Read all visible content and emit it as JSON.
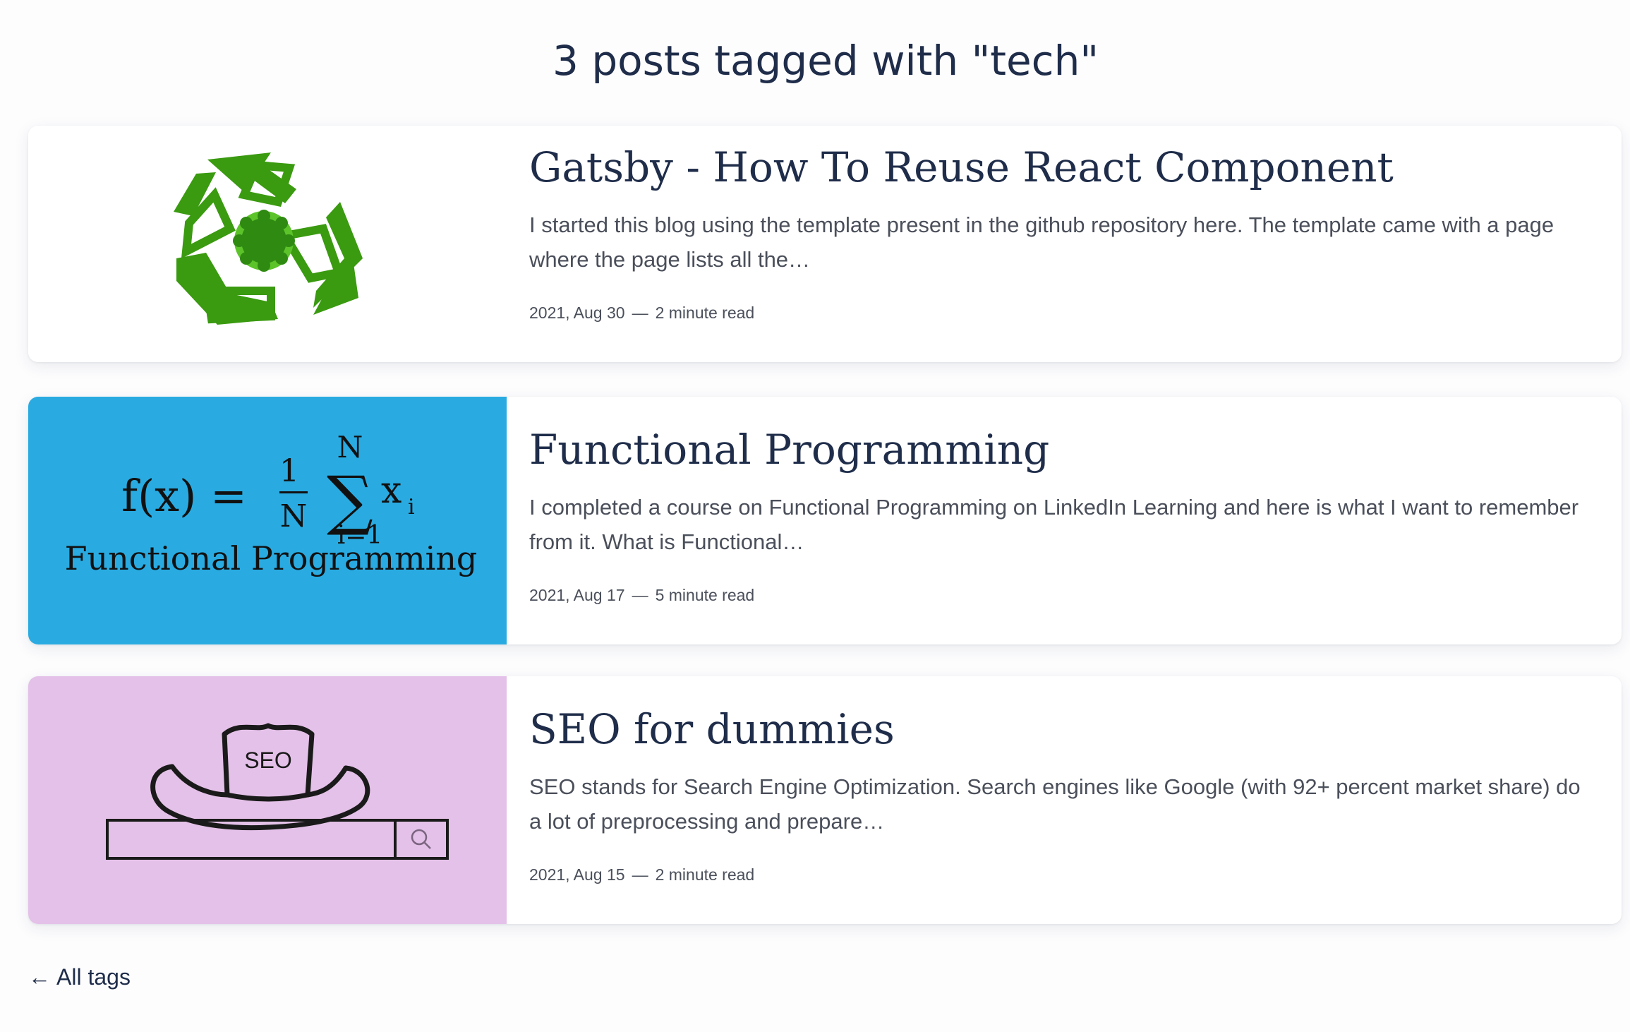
{
  "page": {
    "heading": "3 posts tagged with \"tech\""
  },
  "posts": [
    {
      "title": "Gatsby - How To Reuse React Component",
      "excerpt": "I started this blog using the template present in the github repository here. The template came with a page where the page lists all the…",
      "date": "2021, Aug 30",
      "read_time": "2 minute read",
      "thumbnail_icon": "recycle-icon",
      "thumbnail_bg": "#ffffff"
    },
    {
      "title": "Functional Programming",
      "excerpt": "I completed a course on Functional Programming on LinkedIn Learning and here is what I want to remember from it. What is Functional…",
      "date": "2021, Aug 17",
      "read_time": "5 minute read",
      "thumbnail_icon": "functional-programming-formula",
      "thumbnail_bg": "#29abe2",
      "thumbnail_text": {
        "formula_lhs": "f(x) =",
        "frac_num": "1",
        "frac_den": "N",
        "sum_top": "N",
        "sum_var": "x",
        "sum_sub": "i",
        "sum_bottom": "i=1",
        "caption": "Functional Programming"
      }
    },
    {
      "title": "SEO for dummies",
      "excerpt": "SEO stands for Search Engine Optimization. Search engines like Google (with 92+ percent market share) do a lot of preprocessing and prepare…",
      "date": "2021, Aug 15",
      "read_time": "2 minute read",
      "thumbnail_icon": "seo-hat-icon",
      "thumbnail_bg": "#e4c1e8",
      "thumbnail_text": {
        "hat_label": "SEO"
      }
    }
  ],
  "meta_separator": "—",
  "footer": {
    "back_arrow": "←",
    "back_label": "All tags"
  },
  "colors": {
    "heading": "#1f2d4a",
    "body_text": "#4a4f5a",
    "recycle_green": "#3a9a10"
  }
}
